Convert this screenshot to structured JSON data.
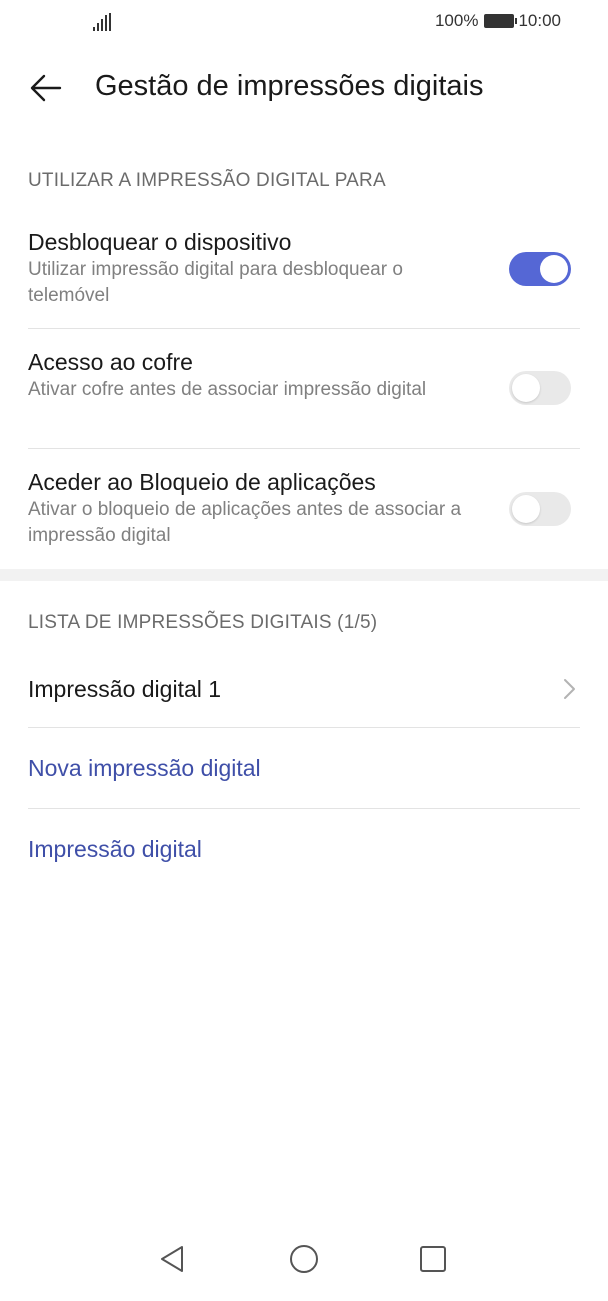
{
  "status_bar": {
    "battery_percent": "100%",
    "time": "10:00"
  },
  "header": {
    "title": "Gestão de impressões digitais"
  },
  "section_usage": {
    "header": "UTILIZAR A IMPRESSÃO DIGITAL PARA",
    "items": [
      {
        "title": "Desbloquear o dispositivo",
        "subtitle": "Utilizar impressão digital para desbloquear o telemóvel",
        "enabled": true
      },
      {
        "title": "Acesso ao cofre",
        "subtitle": "Ativar cofre antes de associar impressão digital",
        "enabled": false
      },
      {
        "title": "Aceder ao Bloqueio de aplicações",
        "subtitle": "Ativar o bloqueio de aplicações antes de associar a impressão digital",
        "enabled": false
      }
    ]
  },
  "section_list": {
    "header": "LISTA DE IMPRESSÕES DIGITAIS (1/5)",
    "fingerprint_item": "Impressão digital 1",
    "new_fingerprint": "Nova impressão digital",
    "fingerprint_link": "Impressão digital"
  },
  "colors": {
    "accent": "#5567d5",
    "link": "#3f4fa8"
  }
}
